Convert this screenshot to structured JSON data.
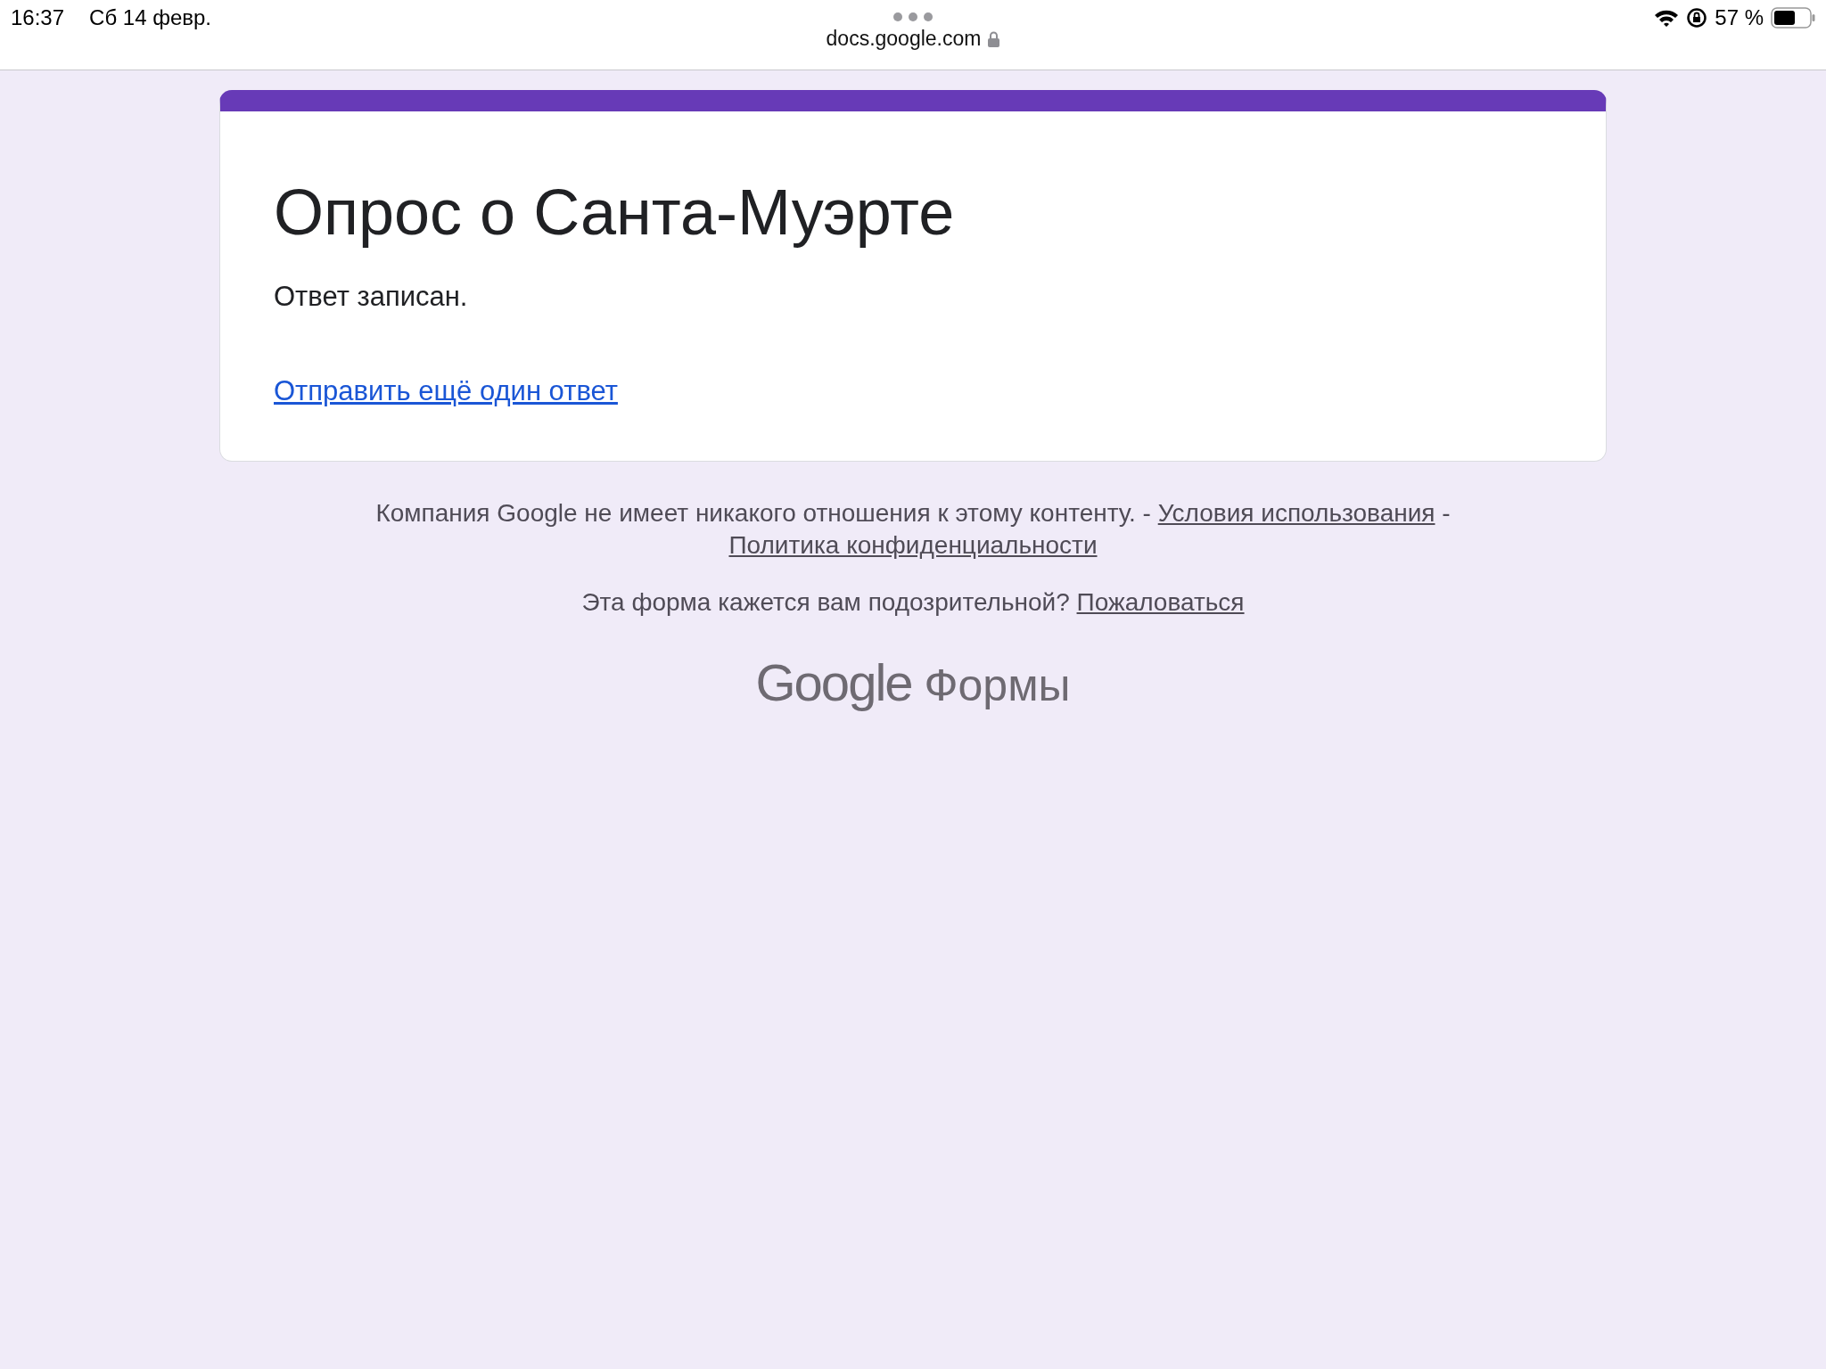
{
  "status_bar": {
    "time": "16:37",
    "date": "Сб 14 февр.",
    "battery": "57 %"
  },
  "address_bar": {
    "url": "docs.google.com"
  },
  "form": {
    "title": "Опрос о Санта-Муэрте",
    "message": "Ответ записан.",
    "link": "Отправить ещё один ответ"
  },
  "footer": {
    "disclaimer": "Компания Google не имеет никакого отношения к этому контенту. -",
    "terms": "Условия использования",
    "separator": "-",
    "privacy": "Политика конфиденциальности",
    "question": "Эта форма кажется вам подозрительной?",
    "report": "Пожаловаться"
  },
  "logo": {
    "brand": "Google",
    "product": "Формы"
  }
}
